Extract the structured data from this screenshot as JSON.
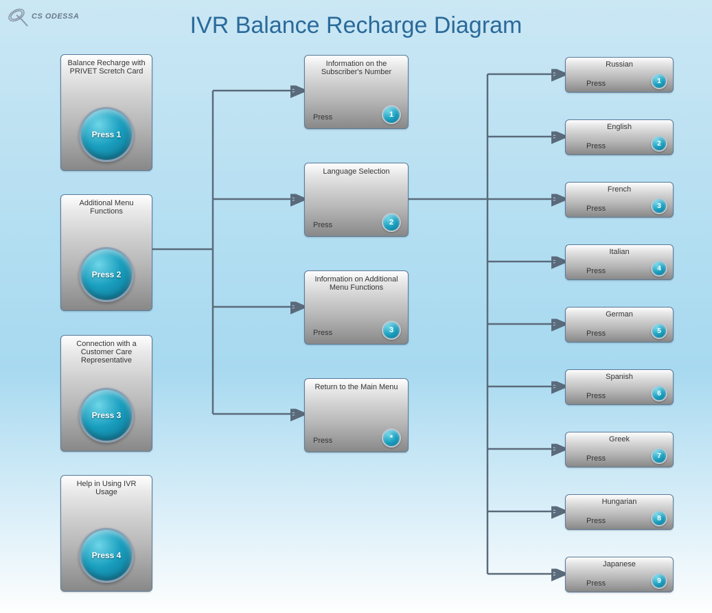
{
  "title": "IVR Balance Recharge Diagram",
  "logo_text": "CS ODESSA",
  "press_label": "Press",
  "main_menu": [
    {
      "label": "Balance Recharge with PRIVET Scretch Card",
      "button": "Press 1"
    },
    {
      "label": "Additional Menu Functions",
      "button": "Press 2"
    },
    {
      "label": "Connection with a Customer Care Representative",
      "button": "Press 3"
    },
    {
      "label": "Help in Using IVR Usage",
      "button": "Press 4"
    }
  ],
  "sub_menu": [
    {
      "label": "Information on the Subscriber's Number",
      "key": "1"
    },
    {
      "label": "Language Selection",
      "key": "2"
    },
    {
      "label": "Information on Additional Menu Functions",
      "key": "3"
    },
    {
      "label": "Return to the Main Menu",
      "key": "*"
    }
  ],
  "languages": [
    {
      "label": "Russian",
      "key": "1"
    },
    {
      "label": "English",
      "key": "2"
    },
    {
      "label": "French",
      "key": "3"
    },
    {
      "label": "Italian",
      "key": "4"
    },
    {
      "label": "German",
      "key": "5"
    },
    {
      "label": "Spanish",
      "key": "6"
    },
    {
      "label": "Greek",
      "key": "7"
    },
    {
      "label": "Hungarian",
      "key": "8"
    },
    {
      "label": "Japanese",
      "key": "9"
    }
  ]
}
